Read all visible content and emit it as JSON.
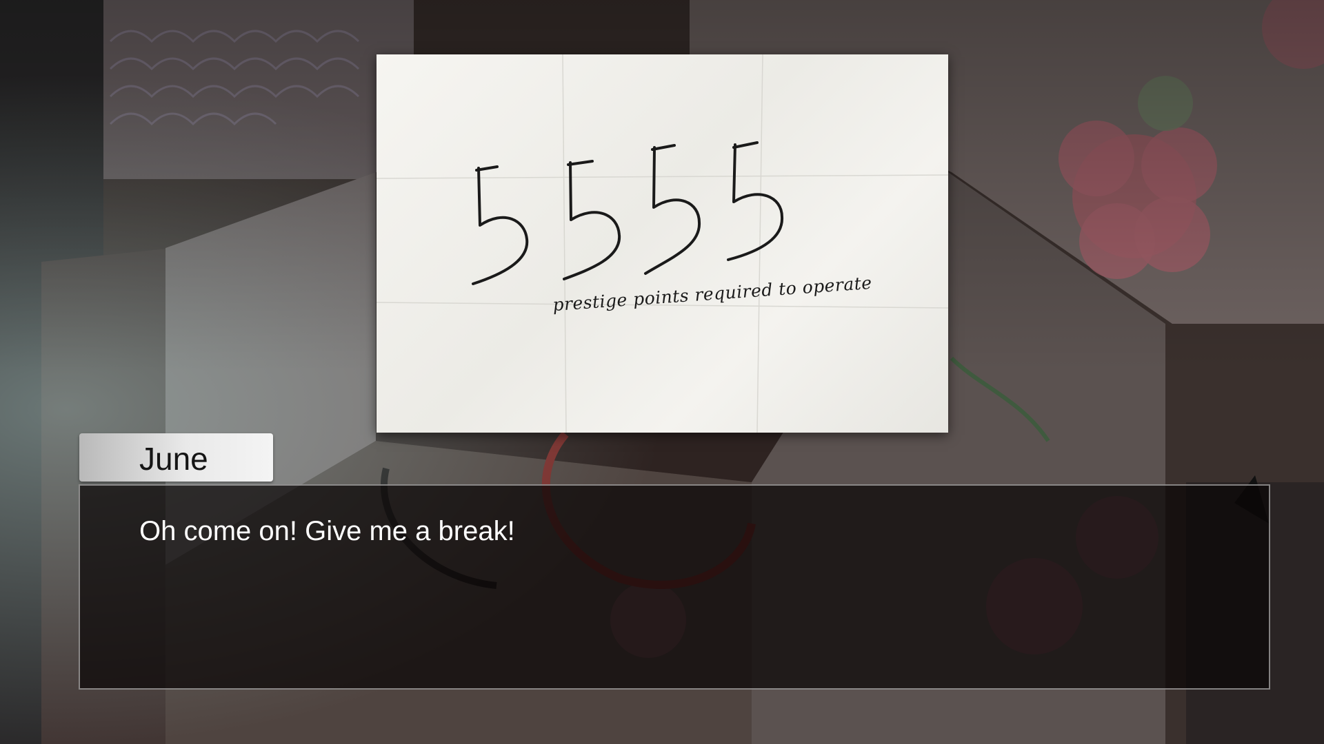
{
  "note": {
    "number": "5555",
    "caption": "prestige points required to operate"
  },
  "dialogue": {
    "speaker": "June",
    "line": "Oh come on! Give me a break!"
  },
  "colors": {
    "dialogue_text": "#ffffff",
    "nameplate_text": "#151515",
    "paper": "#f2f1ed",
    "ink": "#1a1a1a"
  }
}
